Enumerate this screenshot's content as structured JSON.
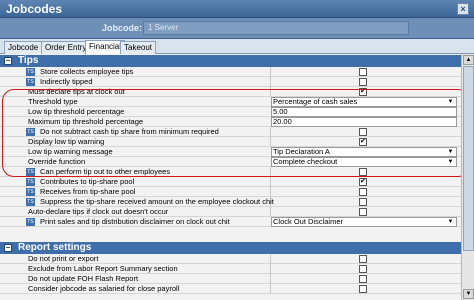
{
  "window": {
    "title": "Jobcodes",
    "close_glyph": "×"
  },
  "jobcode": {
    "label": "Jobcode:",
    "value": "1 Server"
  },
  "tabs": [
    "Jobcode",
    "Order Entry",
    "Financial",
    "Takeout"
  ],
  "sections": {
    "tips": {
      "title": "Tips",
      "toggle": "−"
    },
    "report": {
      "title": "Report settings",
      "toggle": "−"
    }
  },
  "tips_rows": [
    {
      "label": "Store collects employee tips",
      "icon": true,
      "checked": false
    },
    {
      "label": "Indirectly tipped",
      "icon": true,
      "checked": false
    },
    {
      "label": "Must declare tips at clock out",
      "icon": false,
      "checked": true
    },
    {
      "label": "Threshold type",
      "value": "Percentage of cash sales",
      "dropdown": true
    },
    {
      "label": "Low tip threshold percentage",
      "value": "5.00"
    },
    {
      "label": "Maximum tip threshold percentage",
      "value": "20.00"
    },
    {
      "label": "Do not subtract cash tip share from minimum required",
      "icon": true,
      "checked": false
    },
    {
      "label": "Display low tip warning",
      "icon": false,
      "checked": true
    },
    {
      "label": "Low tip warning message",
      "value": "Tip Declaration A",
      "dropdown": true
    },
    {
      "label": "Override function",
      "value": "Complete checkout",
      "dropdown": true
    },
    {
      "label": "Can perform tip out to other employees",
      "icon": true,
      "checked": false
    },
    {
      "label": "Contributes to tip-share pool",
      "icon": true,
      "checked": true
    },
    {
      "label": "Receives from tip-share pool",
      "icon": true,
      "checked": false
    },
    {
      "label": "Suppress the tip-share received amount on the employee clockout chit",
      "icon": true,
      "checked": false
    },
    {
      "label": "Auto-declare tips if clock out doesn't occur",
      "icon": false,
      "checked": false
    },
    {
      "label": "Print sales and tip distribution disclaimer on clock out chit",
      "icon": true,
      "value": "Clock Out Disclaimer",
      "dropdown": true
    }
  ],
  "report_rows": [
    {
      "label": "Do not print or export",
      "checked": false
    },
    {
      "label": "Exclude from Labor Report Summary section",
      "checked": false
    },
    {
      "label": "Do not update FOH Flash Report",
      "checked": false
    },
    {
      "label": "Consider jobcode as salaried for close payroll",
      "checked": false
    }
  ],
  "icons": {
    "row_icon": "tip-setting-icon",
    "checkmark": "✔",
    "dropdown": "▼",
    "scroll_up": "▲",
    "scroll_down": "▼"
  },
  "colors": {
    "title_bar": "#3b6595",
    "section_header": "#3f6fab",
    "highlight": "#d01818"
  }
}
